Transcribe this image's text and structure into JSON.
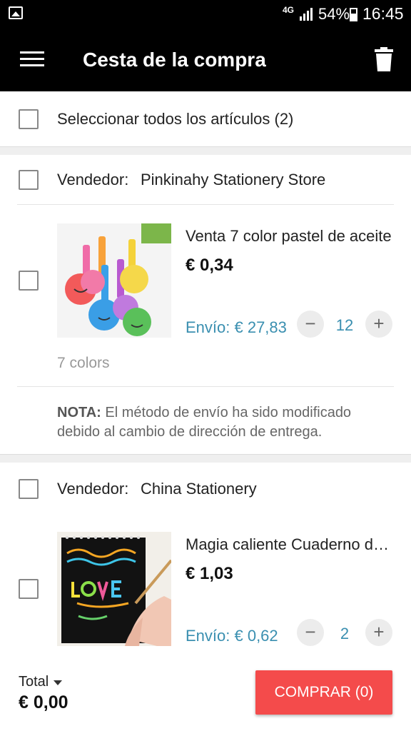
{
  "status_bar": {
    "network": "4G",
    "battery_percent": "54%",
    "time": "16:45"
  },
  "app_bar": {
    "title": "Cesta de la compra"
  },
  "select_all": {
    "label": "Seleccionar todos los artículos (2)",
    "checked": false
  },
  "sellers": [
    {
      "label": "Vendedor:",
      "name": "Pinkinahy Stationery Store",
      "items": [
        {
          "title": "Venta 7 color pastel de aceite",
          "price": "€ 0,34",
          "shipping": "Envío: € 27,83",
          "quantity": "12",
          "variant": "7 colors"
        }
      ],
      "note_bold": "NOTA:",
      "note_text": " El método de envío ha sido modificado debido al cambio de dirección de entrega."
    },
    {
      "label": "Vendedor:",
      "name": "China Stationery",
      "items": [
        {
          "title": "Magia caliente Cuaderno de dibujo",
          "price": "€ 1,03",
          "shipping": "Envío: € 0,62",
          "quantity": "2"
        }
      ]
    }
  ],
  "bottom_bar": {
    "total_label": "Total",
    "total_value": "€ 0,00",
    "buy_label": "COMPRAR (0)"
  },
  "icons": {
    "qty_minus": "−",
    "qty_plus": "+"
  },
  "colors": {
    "accent_buy": "#f44b4b",
    "shipping_text": "#3a8fb0",
    "app_bar": "#000000"
  }
}
